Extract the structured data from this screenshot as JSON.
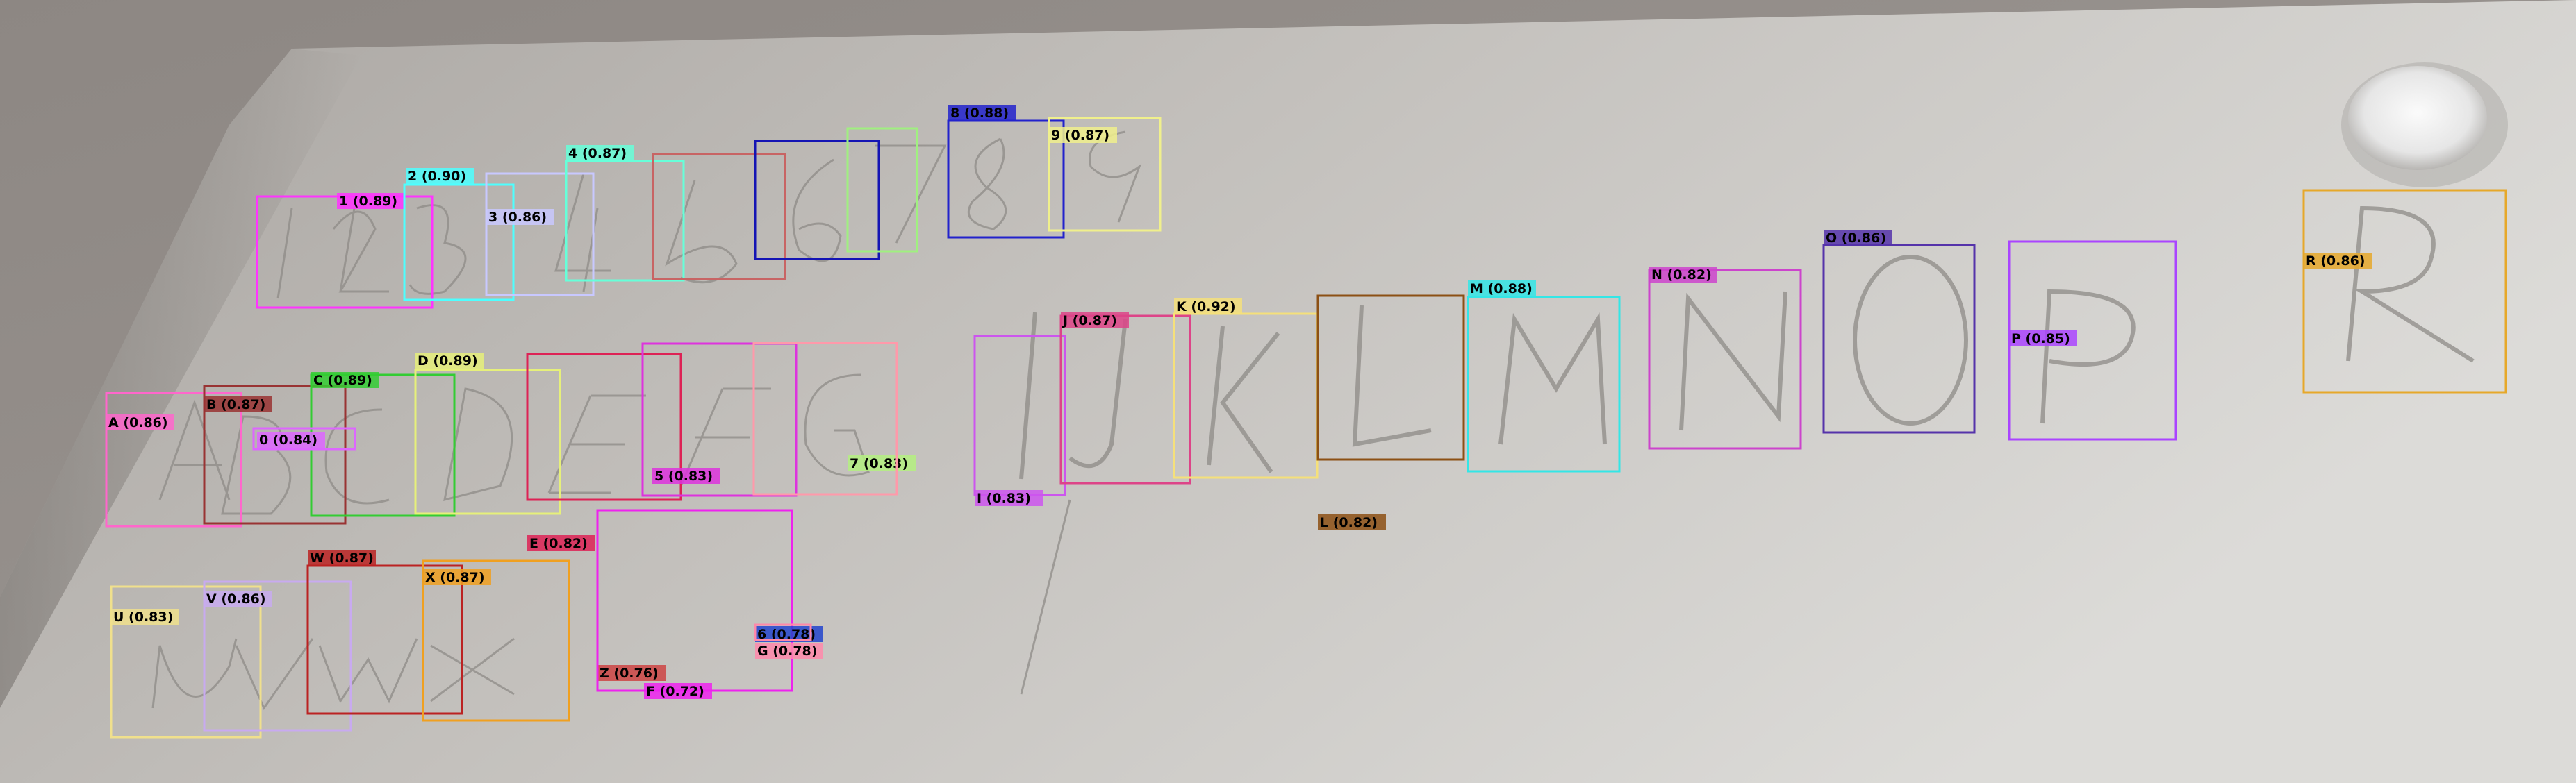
{
  "detections": [
    {
      "label": "1 (0.89)",
      "color": "#ff33ff",
      "text_color": "#000000"
    },
    {
      "label": "2 (0.90)",
      "color": "#4dffff",
      "text_color": "#000000"
    },
    {
      "label": "3 (0.86)",
      "color": "#c8c8ff",
      "text_color": "#000000"
    },
    {
      "label": "4 (0.87)",
      "color": "#66ffd9",
      "text_color": "#000000"
    },
    {
      "label": "",
      "color": "#c86464",
      "text_color": "#000000"
    },
    {
      "label": "",
      "color": "#1414b4",
      "text_color": "#000000"
    },
    {
      "label": "",
      "color": "#a0f080",
      "text_color": "#000000"
    },
    {
      "label": "8 (0.88)",
      "color": "#2222cc",
      "text_color": "#000000"
    },
    {
      "label": "9 (0.87)",
      "color": "#f0f08c",
      "text_color": "#000000"
    },
    {
      "label": "A (0.86)",
      "color": "#ff66cc",
      "text_color": "#000000"
    },
    {
      "label": "B (0.87)",
      "color": "#993333",
      "text_color": "#000000"
    },
    {
      "label": "C (0.89)",
      "color": "#33cc33",
      "text_color": "#000000"
    },
    {
      "label": "0 (0.84)",
      "color": "#dd66ff",
      "text_color": "#000000"
    },
    {
      "label": "D (0.89)",
      "color": "#e6f07a",
      "text_color": "#000000"
    },
    {
      "label": "E (0.82)",
      "color": "#dd2255",
      "text_color": "#000000"
    },
    {
      "label": "5 (0.83)",
      "color": "#dd33dd",
      "text_color": "#000000"
    },
    {
      "label": "7 (0.83)",
      "color": "#b4f080",
      "text_color": "#000000"
    },
    {
      "label": "",
      "color": "#ff99aa",
      "text_color": "#000000"
    },
    {
      "label": "I (0.83)",
      "color": "#cc55ee",
      "text_color": "#000000"
    },
    {
      "label": "J (0.87)",
      "color": "#dd4488",
      "text_color": "#000000"
    },
    {
      "label": "K (0.92)",
      "color": "#f5e07a",
      "text_color": "#000000"
    },
    {
      "label": "L (0.82)",
      "color": "#8c5014",
      "text_color": "#000000"
    },
    {
      "label": "M (0.88)",
      "color": "#33e6e6",
      "text_color": "#000000"
    },
    {
      "label": "N (0.82)",
      "color": "#cc44cc",
      "text_color": "#000000"
    },
    {
      "label": "O (0.86)",
      "color": "#5533aa",
      "text_color": "#000000"
    },
    {
      "label": "P (0.85)",
      "color": "#aa44ff",
      "text_color": "#000000"
    },
    {
      "label": "R (0.86)",
      "color": "#e6a82a",
      "text_color": "#000000"
    },
    {
      "label": "U (0.83)",
      "color": "#f0e08c",
      "text_color": "#000000"
    },
    {
      "label": "V (0.86)",
      "color": "#c8aaf0",
      "text_color": "#000000"
    },
    {
      "label": "W (0.87)",
      "color": "#bb2222",
      "text_color": "#000000"
    },
    {
      "label": "X (0.87)",
      "color": "#f0a020",
      "text_color": "#000000"
    },
    {
      "label": "Z (0.76)",
      "color": "#cc4444",
      "text_color": "#000000"
    },
    {
      "label": "F (0.72)",
      "color": "#ee22ee",
      "text_color": "#000000"
    },
    {
      "label": "6 (0.78)",
      "color": "#2244cc",
      "text_color": "#000000"
    },
    {
      "label": "G (0.78)",
      "color": "#ff88aa",
      "text_color": "#000000"
    }
  ]
}
